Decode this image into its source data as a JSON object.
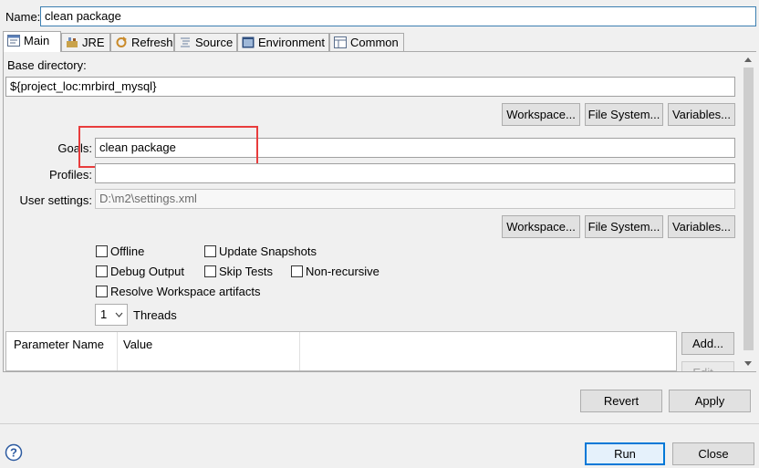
{
  "name_field": {
    "label": "Name:",
    "value": "clean package"
  },
  "tabs": [
    {
      "label": "Main",
      "icon": "main-tab-icon"
    },
    {
      "label": "JRE",
      "icon": "jre-icon"
    },
    {
      "label": "Refresh",
      "icon": "refresh-icon"
    },
    {
      "label": "Source",
      "icon": "source-icon"
    },
    {
      "label": "Environment",
      "icon": "environment-icon"
    },
    {
      "label": "Common",
      "icon": "common-icon"
    }
  ],
  "main": {
    "base_directory_label": "Base directory:",
    "base_directory_value": "${project_loc:mrbird_mysql}",
    "buttons_row1": {
      "workspace": "Workspace...",
      "file_system": "File System...",
      "variables": "Variables..."
    },
    "goals_label": "Goals:",
    "goals_value": "clean package",
    "profiles_label": "Profiles:",
    "profiles_value": "",
    "user_settings_label": "User settings:",
    "user_settings_value": "D:\\m2\\settings.xml",
    "buttons_row2": {
      "workspace": "Workspace...",
      "file_system": "File System...",
      "variables": "Variables..."
    },
    "options": {
      "offline": "Offline",
      "update_snapshots": "Update Snapshots",
      "debug_output": "Debug Output",
      "skip_tests": "Skip Tests",
      "non_recursive": "Non-recursive",
      "resolve_workspace": "Resolve Workspace artifacts"
    },
    "threads_value": "1",
    "threads_label": "Threads",
    "params_table": {
      "columns": [
        "Parameter Name",
        "Value"
      ]
    },
    "add_button": "Add...",
    "edit_button": "Edit..."
  },
  "footer": {
    "revert": "Revert",
    "apply": "Apply",
    "run": "Run",
    "close": "Close",
    "help_icon": "help-icon"
  },
  "colors": {
    "highlight": "#e83c3c",
    "focus": "#0078d7"
  }
}
